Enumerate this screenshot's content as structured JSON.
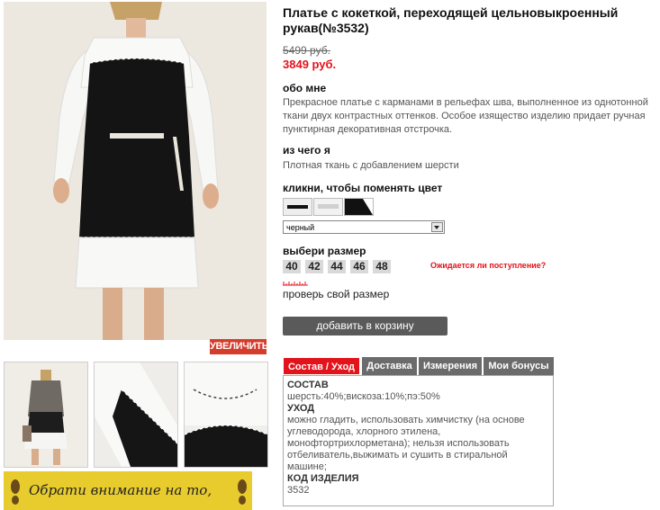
{
  "product": {
    "title": "Платье с кокеткой, переходящей цельновыкроенный рукав(№3532)",
    "old_price": "5499 руб.",
    "new_price": "3849 руб.",
    "zoom_label": "УВЕЛИЧИТЬ"
  },
  "about": {
    "heading": "обо мне",
    "text": "Прекрасное платье с карманами в рельефах шва, выполненное из однотонной ткани двух контрастных оттенков. Особое изящество изделию придает ручная пунктирная декоративная отстрочка."
  },
  "material": {
    "heading": "из чего я",
    "text": "Плотная ткань с добавлением шерсти"
  },
  "color": {
    "heading": "кликни, чтобы поменять цвет",
    "selected": "черный"
  },
  "size": {
    "heading": "выбери размер",
    "options": [
      "40",
      "42",
      "44",
      "46",
      "48"
    ],
    "expect_link": "Ожидается ли поступление?",
    "check_link": "проверь свой размер"
  },
  "cart": {
    "label": "добавить в корзину"
  },
  "tabs": [
    "Состав / Уход",
    "Доставка",
    "Измерения",
    "Мои бонусы"
  ],
  "details": {
    "composition_heading": "СОСТАВ",
    "composition": "шерсть:40%;вискоза:10%;пэ:50%",
    "care_heading": "УХОД",
    "care": "можно гладить, использовать химчистку (на основе углеводорода, хлорного этилена, монофтортрихлорметана); нельзя использовать отбеливатель,выжимать и сушить в стиральной машине;",
    "code_heading": "КОД ИЗДЕЛИЯ",
    "code": "3532"
  },
  "banner": {
    "text": "Обрати внимание на то,"
  },
  "colors": {
    "accent_red": "#e3131b",
    "tab_active": "#e3131b",
    "tab_inactive": "#6b6b6b",
    "cart_button": "#5a5a5a"
  }
}
